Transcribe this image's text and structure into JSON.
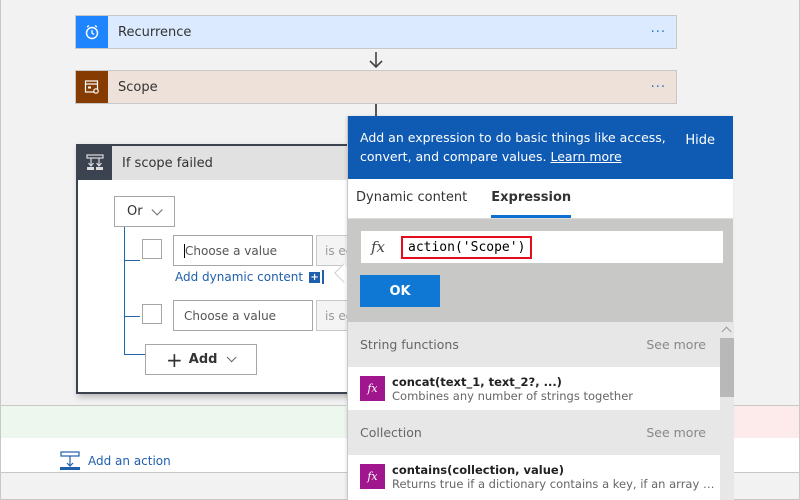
{
  "flow": {
    "recurrence": {
      "title": "Recurrence",
      "icon": "alarm-clock-icon",
      "more": "···",
      "color": "#1f85ff"
    },
    "scope": {
      "title": "Scope",
      "icon": "scope-icon",
      "more": "···",
      "color": "#863b00"
    }
  },
  "condition": {
    "title": "If scope failed",
    "icon": "condition-icon",
    "group_operator": "Or",
    "rows": [
      {
        "value_placeholder": "Choose a value",
        "operator": "is equal to"
      },
      {
        "value_placeholder": "Choose a value",
        "operator": "is equal to"
      }
    ],
    "add_dynamic_content": "Add dynamic content",
    "add_button": "Add"
  },
  "footer": {
    "add_action": "Add an action"
  },
  "panel": {
    "banner_text": "Add an expression to do basic things like access, convert, and compare values.",
    "learn_more": "Learn more",
    "hide": "Hide",
    "tabs": [
      {
        "label": "Dynamic content",
        "active": false
      },
      {
        "label": "Expression",
        "active": true
      }
    ],
    "expression": {
      "fx": "fx",
      "value": "action('Scope')"
    },
    "ok_button": "OK",
    "sections": [
      {
        "title": "String functions",
        "see_more": "See more",
        "items": [
          {
            "name": "concat(text_1, text_2?, ...)",
            "description": "Combines any number of strings together"
          }
        ]
      },
      {
        "title": "Collection",
        "see_more": "See more",
        "items": [
          {
            "name": "contains(collection, value)",
            "description": "Returns true if a dictionary contains a key, if an array contains a value, or if a string contains a substring"
          }
        ]
      }
    ]
  }
}
